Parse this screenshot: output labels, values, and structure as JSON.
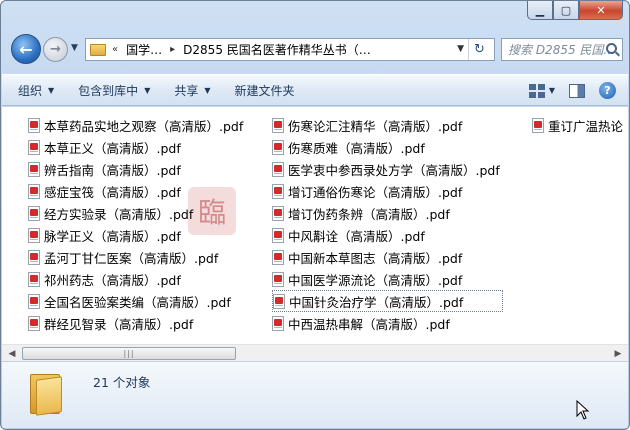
{
  "window": {
    "caption": {
      "minimize": "▁",
      "maximize": "▢",
      "close": "✕"
    }
  },
  "nav": {
    "back": "←",
    "forward": "→",
    "history_arrow": "▼",
    "breadcrumb_prefix": "«",
    "breadcrumbs": [
      "国学…",
      "D2855 民国名医著作精华丛书（…"
    ],
    "breadcrumb_sep": "▸",
    "address_dropdown": "▼",
    "refresh": "↻",
    "search_placeholder": "搜索 D2855 民国..."
  },
  "toolbar": {
    "organize": "组织",
    "include_in_library": "包含到库中",
    "share": "共享",
    "new_folder": "新建文件夹",
    "dropdown_glyph": "▼",
    "help": "?"
  },
  "files": {
    "col1": [
      "本草药品实地之观察（高清版）.pdf",
      "本草正义（高清版）.pdf",
      "辨舌指南（高清版）.pdf",
      "感症宝筏（高清版）.pdf",
      "经方实验录（高清版）.pdf",
      "脉学正义（高清版）.pdf",
      "孟河丁甘仁医案（高清版）.pdf",
      "祁州药志（高清版）.pdf",
      "全国名医验案类编（高清版）.pdf",
      "群经见智录（高清版）.pdf"
    ],
    "col2": [
      "伤寒论汇注精华（高清版）.pdf",
      "伤寒质难（高清版）.pdf",
      "医学衷中参西录处方学（高清版）.pdf",
      "增订通俗伤寒论（高清版）.pdf",
      "增订伪药条辨（高清版）.pdf",
      "中风斠诠（高清版）.pdf",
      "中国新本草图志（高清版）.pdf",
      "中国医学源流论（高清版）.pdf",
      "中国针灸治疗学（高清版）.pdf",
      "中西温热串解（高清版）.pdf"
    ],
    "col3": [
      "重订广温热论（高清版）.pdf"
    ],
    "selected": "中国针灸治疗学（高清版）.pdf"
  },
  "scrollbar": {
    "left": "◀",
    "right": "▶",
    "grip": "|||"
  },
  "status": {
    "count": "21 个对象"
  },
  "watermark": "臨"
}
